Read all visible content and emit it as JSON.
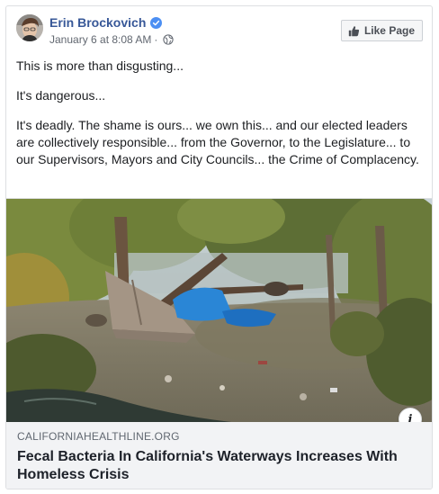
{
  "post": {
    "author": "Erin Brockovich",
    "timestamp": "January 6 at 8:08 AM",
    "separator": "·",
    "like_page_label": "Like Page",
    "paragraphs": [
      "This is more than disgusting...",
      "It's dangerous...",
      "It's deadly. The shame is ours... we own this... and our elected leaders are collectively responsible... from the Governor, to the Legislature... to our Supervisors, Mayors and City Councils... the Crime of Complacency."
    ]
  },
  "link": {
    "domain": "CALIFORNIAHEALTHLINE.ORG",
    "title": "Fecal Bacteria In California's Waterways Increases With Homeless Crisis",
    "info_label": "i"
  },
  "colors": {
    "author_link": "#385898",
    "verified_badge": "#4c8ff3",
    "caption_bg": "#f2f3f5"
  },
  "icons": {
    "verified": "verified-badge-icon",
    "privacy": "globe-icon",
    "like": "thumbs-up-icon",
    "info": "info-icon"
  }
}
